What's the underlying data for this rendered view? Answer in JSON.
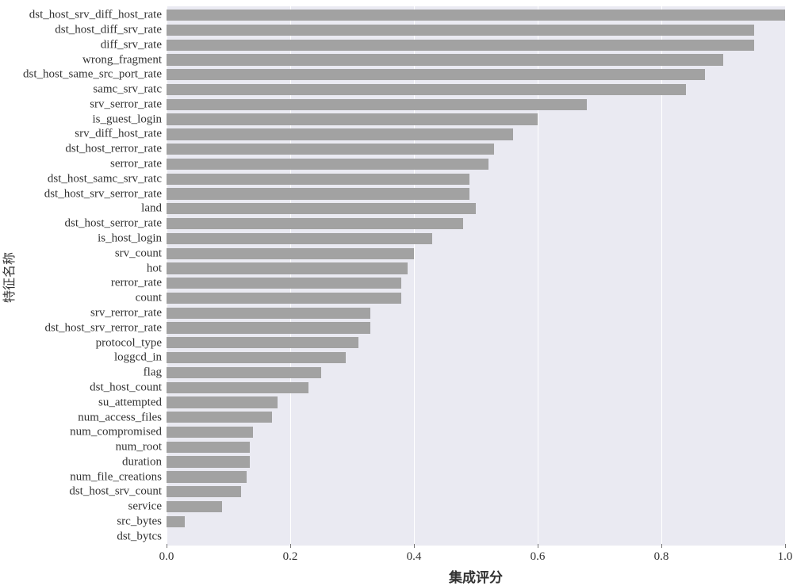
{
  "chart_data": {
    "type": "bar",
    "orientation": "horizontal",
    "xlabel": "集成评分",
    "ylabel": "特征名称",
    "xlim": [
      0.0,
      1.0
    ],
    "xticks": [
      0.0,
      0.2,
      0.4,
      0.6,
      0.8,
      1.0
    ],
    "categories": [
      "dst_host_srv_diff_host_rate",
      "dst_host_diff_srv_rate",
      "diff_srv_rate",
      "wrong_fragment",
      "dst_host_same_src_port_rate",
      "samc_srv_ratc",
      "srv_serror_rate",
      "is_guest_login",
      "srv_diff_host_rate",
      "dst_host_rerror_rate",
      "serror_rate",
      "dst_host_samc_srv_ratc",
      "dst_host_srv_serror_rate",
      "land",
      "dst_host_serror_rate",
      "is_host_login",
      "srv_count",
      "hot",
      "rerror_rate",
      "count",
      "srv_rerror_rate",
      "dst_host_srv_rerror_rate",
      "protocol_type",
      "loggcd_in",
      "flag",
      "dst_host_count",
      "su_attempted",
      "num_access_files",
      "num_compromised",
      "num_root",
      "duration",
      "num_file_creations",
      "dst_host_srv_count",
      "service",
      "src_bytes",
      "dst_bytcs"
    ],
    "values": [
      1.0,
      0.95,
      0.95,
      0.9,
      0.87,
      0.84,
      0.68,
      0.6,
      0.56,
      0.53,
      0.52,
      0.49,
      0.49,
      0.5,
      0.48,
      0.43,
      0.4,
      0.39,
      0.38,
      0.38,
      0.33,
      0.33,
      0.31,
      0.29,
      0.25,
      0.23,
      0.18,
      0.17,
      0.14,
      0.135,
      0.135,
      0.13,
      0.12,
      0.09,
      0.03,
      0.0
    ]
  }
}
